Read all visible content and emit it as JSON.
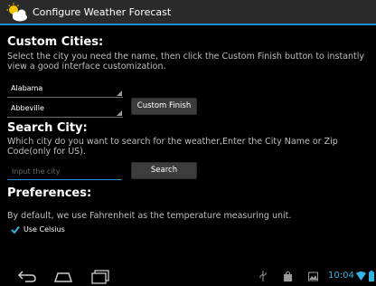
{
  "app": {
    "title": "Configure Weather Forecast",
    "icon": "partly-cloudy-icon"
  },
  "custom_cities": {
    "header": "Custom Cities:",
    "description": "Select the city you need the name, then click the Custom Finish button to instantly view a good interface customization.",
    "state_select": "Alabama",
    "city_select": "Abbeville",
    "finish_button": "Custom Finish"
  },
  "search_city": {
    "header": "Search City:",
    "description": "Which city do you want to search for the weather,Enter the City Name or Zip Code(only for US).",
    "input_placeholder": "Input the city",
    "input_value": "",
    "search_button": "Search"
  },
  "preferences": {
    "header": "Preferences:",
    "description": "By default, we use Fahrenheit as the temperature measuring unit.",
    "celsius_label": "Use Celsius",
    "celsius_checked": true
  },
  "navigation": {
    "back_icon": "back-icon",
    "home_icon": "home-icon",
    "recent_apps_icon": "recent-apps-icon"
  },
  "status_bar": {
    "time": "10:04",
    "icons": [
      "usb-icon",
      "shopping-bag-icon",
      "gallery-icon",
      "wifi-icon",
      "battery-icon"
    ]
  },
  "colors": {
    "accent": "#33b5e5",
    "title_underline": "#1c8ed6",
    "background": "#000000",
    "button": "#3c3c3c"
  }
}
